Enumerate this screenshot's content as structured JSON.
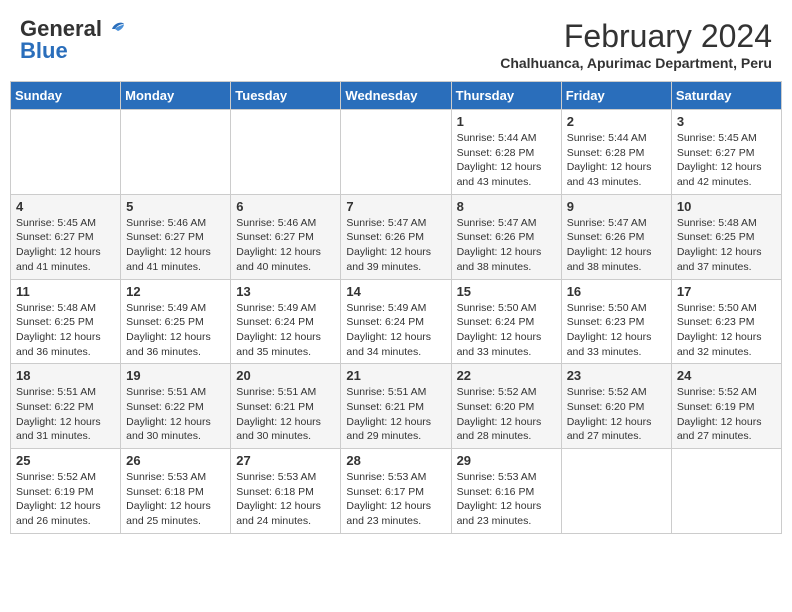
{
  "header": {
    "logo_general": "General",
    "logo_blue": "Blue",
    "month_year": "February 2024",
    "location": "Chalhuanca, Apurimac Department, Peru"
  },
  "weekdays": [
    "Sunday",
    "Monday",
    "Tuesday",
    "Wednesday",
    "Thursday",
    "Friday",
    "Saturday"
  ],
  "weeks": [
    [
      {
        "day": "",
        "info": ""
      },
      {
        "day": "",
        "info": ""
      },
      {
        "day": "",
        "info": ""
      },
      {
        "day": "",
        "info": ""
      },
      {
        "day": "1",
        "info": "Sunrise: 5:44 AM\nSunset: 6:28 PM\nDaylight: 12 hours\nand 43 minutes."
      },
      {
        "day": "2",
        "info": "Sunrise: 5:44 AM\nSunset: 6:28 PM\nDaylight: 12 hours\nand 43 minutes."
      },
      {
        "day": "3",
        "info": "Sunrise: 5:45 AM\nSunset: 6:27 PM\nDaylight: 12 hours\nand 42 minutes."
      }
    ],
    [
      {
        "day": "4",
        "info": "Sunrise: 5:45 AM\nSunset: 6:27 PM\nDaylight: 12 hours\nand 41 minutes."
      },
      {
        "day": "5",
        "info": "Sunrise: 5:46 AM\nSunset: 6:27 PM\nDaylight: 12 hours\nand 41 minutes."
      },
      {
        "day": "6",
        "info": "Sunrise: 5:46 AM\nSunset: 6:27 PM\nDaylight: 12 hours\nand 40 minutes."
      },
      {
        "day": "7",
        "info": "Sunrise: 5:47 AM\nSunset: 6:26 PM\nDaylight: 12 hours\nand 39 minutes."
      },
      {
        "day": "8",
        "info": "Sunrise: 5:47 AM\nSunset: 6:26 PM\nDaylight: 12 hours\nand 38 minutes."
      },
      {
        "day": "9",
        "info": "Sunrise: 5:47 AM\nSunset: 6:26 PM\nDaylight: 12 hours\nand 38 minutes."
      },
      {
        "day": "10",
        "info": "Sunrise: 5:48 AM\nSunset: 6:25 PM\nDaylight: 12 hours\nand 37 minutes."
      }
    ],
    [
      {
        "day": "11",
        "info": "Sunrise: 5:48 AM\nSunset: 6:25 PM\nDaylight: 12 hours\nand 36 minutes."
      },
      {
        "day": "12",
        "info": "Sunrise: 5:49 AM\nSunset: 6:25 PM\nDaylight: 12 hours\nand 36 minutes."
      },
      {
        "day": "13",
        "info": "Sunrise: 5:49 AM\nSunset: 6:24 PM\nDaylight: 12 hours\nand 35 minutes."
      },
      {
        "day": "14",
        "info": "Sunrise: 5:49 AM\nSunset: 6:24 PM\nDaylight: 12 hours\nand 34 minutes."
      },
      {
        "day": "15",
        "info": "Sunrise: 5:50 AM\nSunset: 6:24 PM\nDaylight: 12 hours\nand 33 minutes."
      },
      {
        "day": "16",
        "info": "Sunrise: 5:50 AM\nSunset: 6:23 PM\nDaylight: 12 hours\nand 33 minutes."
      },
      {
        "day": "17",
        "info": "Sunrise: 5:50 AM\nSunset: 6:23 PM\nDaylight: 12 hours\nand 32 minutes."
      }
    ],
    [
      {
        "day": "18",
        "info": "Sunrise: 5:51 AM\nSunset: 6:22 PM\nDaylight: 12 hours\nand 31 minutes."
      },
      {
        "day": "19",
        "info": "Sunrise: 5:51 AM\nSunset: 6:22 PM\nDaylight: 12 hours\nand 30 minutes."
      },
      {
        "day": "20",
        "info": "Sunrise: 5:51 AM\nSunset: 6:21 PM\nDaylight: 12 hours\nand 30 minutes."
      },
      {
        "day": "21",
        "info": "Sunrise: 5:51 AM\nSunset: 6:21 PM\nDaylight: 12 hours\nand 29 minutes."
      },
      {
        "day": "22",
        "info": "Sunrise: 5:52 AM\nSunset: 6:20 PM\nDaylight: 12 hours\nand 28 minutes."
      },
      {
        "day": "23",
        "info": "Sunrise: 5:52 AM\nSunset: 6:20 PM\nDaylight: 12 hours\nand 27 minutes."
      },
      {
        "day": "24",
        "info": "Sunrise: 5:52 AM\nSunset: 6:19 PM\nDaylight: 12 hours\nand 27 minutes."
      }
    ],
    [
      {
        "day": "25",
        "info": "Sunrise: 5:52 AM\nSunset: 6:19 PM\nDaylight: 12 hours\nand 26 minutes."
      },
      {
        "day": "26",
        "info": "Sunrise: 5:53 AM\nSunset: 6:18 PM\nDaylight: 12 hours\nand 25 minutes."
      },
      {
        "day": "27",
        "info": "Sunrise: 5:53 AM\nSunset: 6:18 PM\nDaylight: 12 hours\nand 24 minutes."
      },
      {
        "day": "28",
        "info": "Sunrise: 5:53 AM\nSunset: 6:17 PM\nDaylight: 12 hours\nand 23 minutes."
      },
      {
        "day": "29",
        "info": "Sunrise: 5:53 AM\nSunset: 6:16 PM\nDaylight: 12 hours\nand 23 minutes."
      },
      {
        "day": "",
        "info": ""
      },
      {
        "day": "",
        "info": ""
      }
    ]
  ]
}
